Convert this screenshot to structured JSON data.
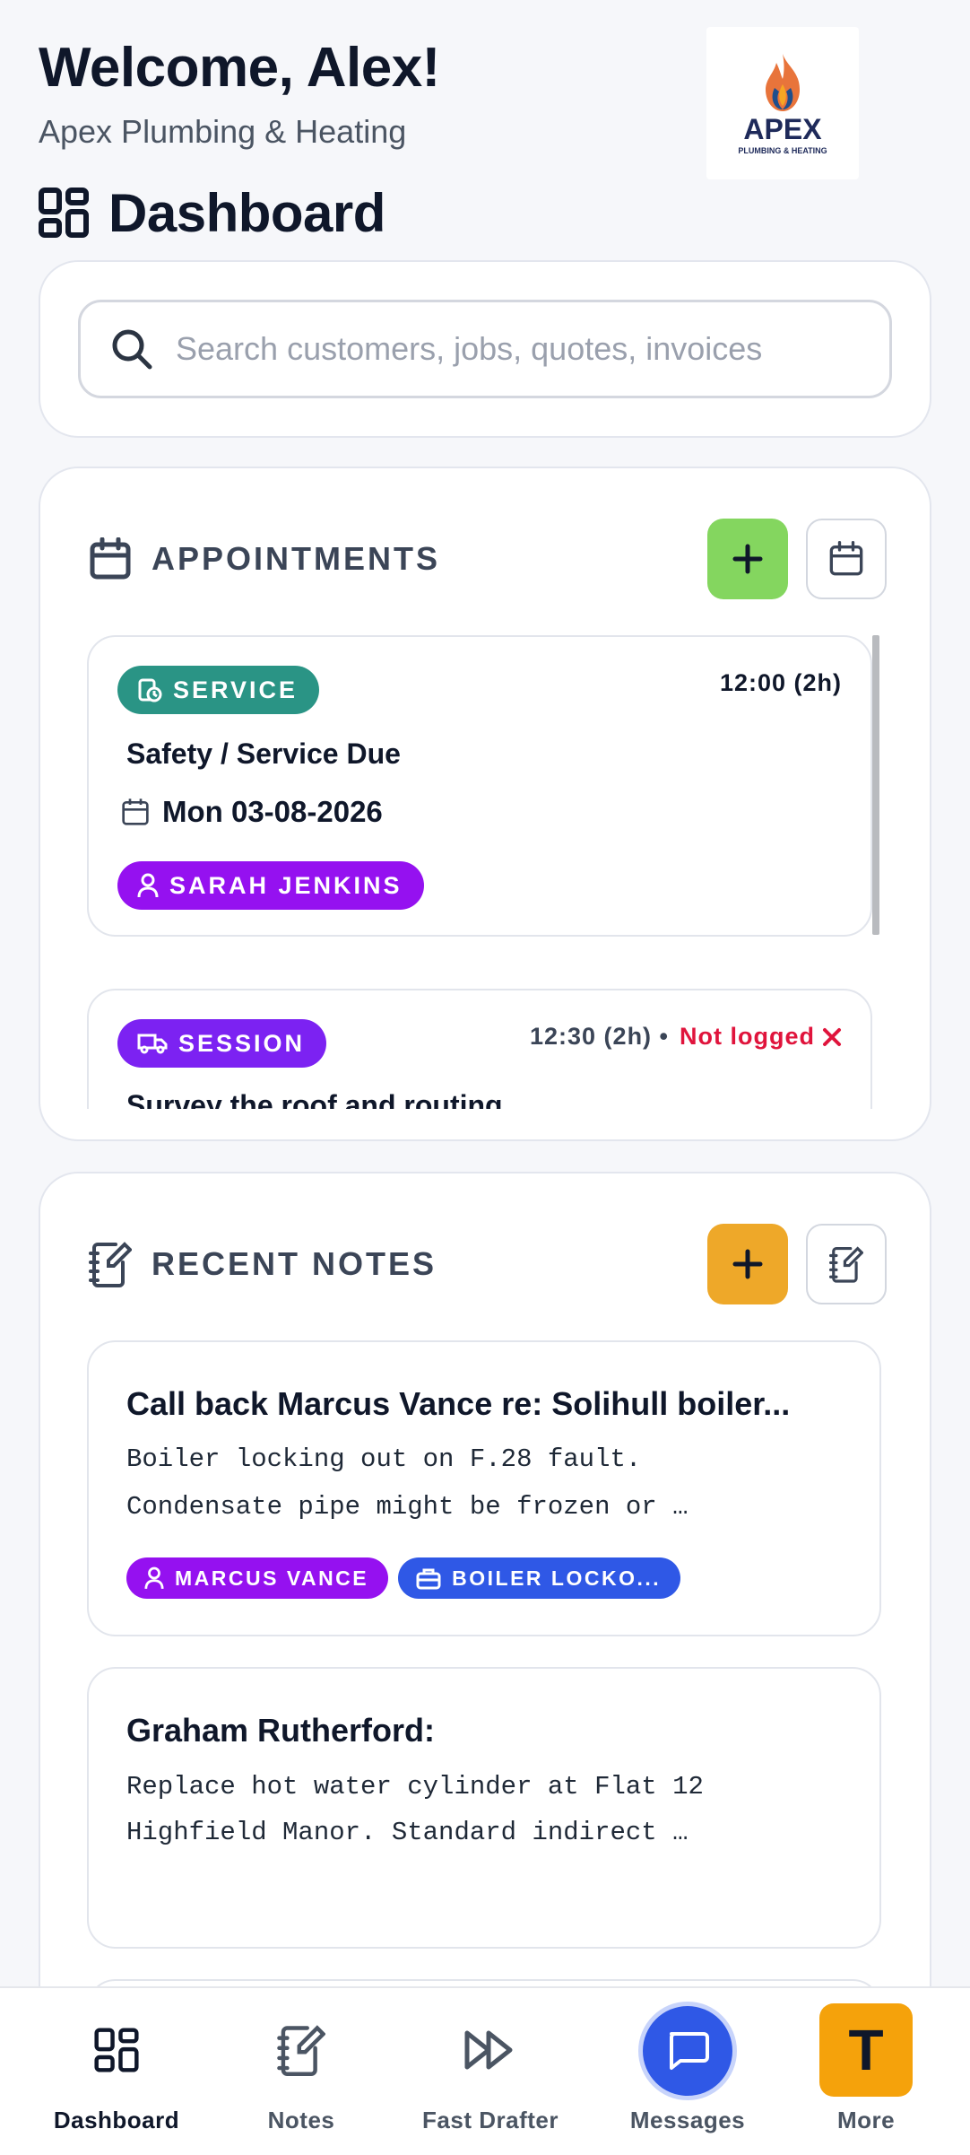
{
  "header": {
    "welcome": "Welcome, Alex!",
    "company": "Apex Plumbing & Heating",
    "logo_text": "APEX",
    "logo_sub": "PLUMBING & HEATING"
  },
  "page_title": "Dashboard",
  "search": {
    "placeholder": "Search customers, jobs, quotes, invoices"
  },
  "appointments": {
    "title": "APPOINTMENTS",
    "add_color": "#84d65f",
    "items": [
      {
        "type": "SERVICE",
        "type_color": "#2a9485",
        "time": "12:00 (2h)",
        "title": "Safety / Service Due",
        "date": "Mon 03-08-2026",
        "customer": "SARAH JENKINS",
        "customer_color": "#9511f0"
      },
      {
        "type": "SESSION",
        "type_color": "#7c22f2",
        "time": "12:30 (2h) •",
        "status": "Not logged",
        "status_icon": "x-icon",
        "status_color": "#e0143c",
        "title": "Survey the roof and routing"
      }
    ]
  },
  "notes": {
    "title": "RECENT NOTES",
    "add_color": "#eea829",
    "items": [
      {
        "title": "Call back Marcus Vance re: Solihull boiler...",
        "body_lines": [
          "Boiler locking out on F.28 fault.",
          "Condensate pipe might be frozen or …"
        ],
        "tags": [
          {
            "label": "MARCUS VANCE",
            "icon": "user-icon",
            "color": "#9511f0"
          },
          {
            "label": "BOILER LOCKO...",
            "icon": "toolbox-icon",
            "color": "#2f58e6"
          }
        ]
      },
      {
        "title": "Graham Rutherford:",
        "body_lines": [
          "Replace hot water cylinder at Flat 12",
          "Highfield Manor. Standard indirect …"
        ]
      }
    ]
  },
  "nav": {
    "items": [
      {
        "label": "Dashboard",
        "icon": "dashboard-icon",
        "active": true
      },
      {
        "label": "Notes",
        "icon": "notes-icon"
      },
      {
        "label": "Fast Drafter",
        "icon": "fast-forward-icon"
      },
      {
        "label": "Messages",
        "icon": "message-icon"
      },
      {
        "label": "More",
        "avatar_letter": "T"
      }
    ]
  }
}
